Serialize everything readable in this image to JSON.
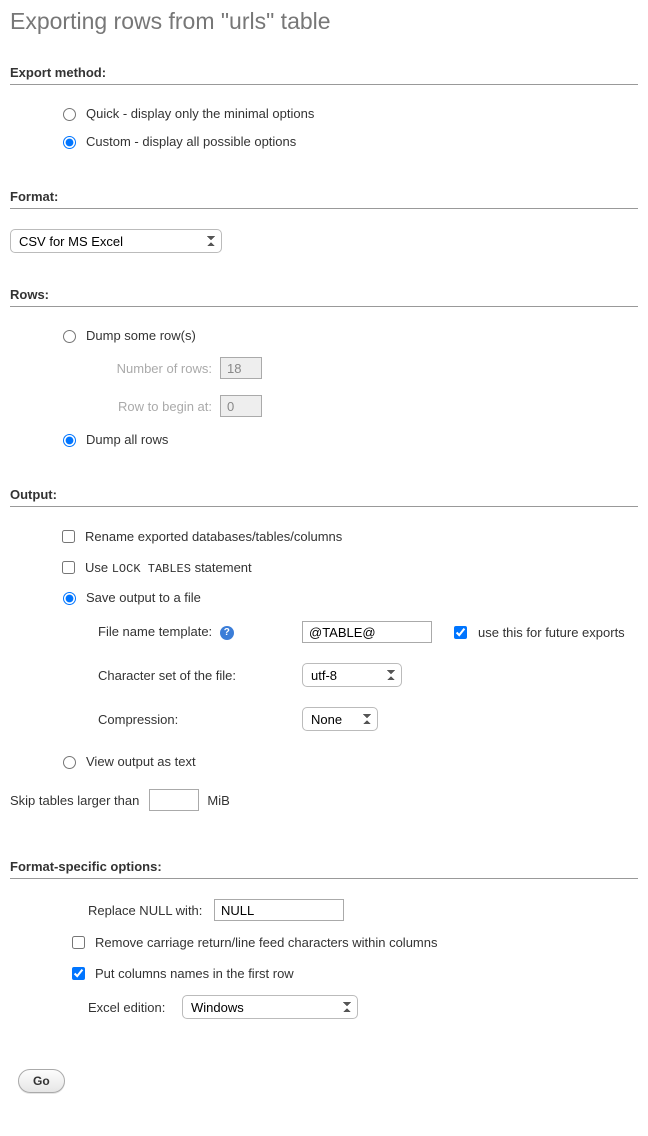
{
  "page_title": "Exporting rows from \"urls\" table",
  "export_method": {
    "legend": "Export method:",
    "quick_label": "Quick - display only the minimal options",
    "custom_label": "Custom - display all possible options"
  },
  "format": {
    "legend": "Format:",
    "selected": "CSV for MS Excel"
  },
  "rows": {
    "legend": "Rows:",
    "dump_some_label": "Dump some row(s)",
    "num_rows_label": "Number of rows:",
    "num_rows_value": "18",
    "row_begin_label": "Row to begin at:",
    "row_begin_value": "0",
    "dump_all_label": "Dump all rows"
  },
  "output": {
    "legend": "Output:",
    "rename_label": "Rename exported databases/tables/columns",
    "lock_tables_prefix": "Use ",
    "lock_tables_code": "LOCK TABLES",
    "lock_tables_suffix": " statement",
    "save_file_label": "Save output to a file",
    "fname_label": "File name template:",
    "fname_value": "@TABLE@",
    "use_future_label": "use this for future exports",
    "charset_label": "Character set of the file:",
    "charset_selected": "utf-8",
    "compression_label": "Compression:",
    "compression_selected": "None",
    "view_text_label": "View output as text",
    "skip_prefix": "Skip tables larger than",
    "skip_value": "",
    "skip_suffix": "MiB"
  },
  "format_specific": {
    "legend": "Format-specific options:",
    "replace_null_label": "Replace NULL with:",
    "replace_null_value": "NULL",
    "remove_crlf_label": "Remove carriage return/line feed characters within columns",
    "put_columns_label": "Put columns names in the first row",
    "excel_edition_label": "Excel edition:",
    "excel_edition_selected": "Windows"
  },
  "go_button": "Go"
}
